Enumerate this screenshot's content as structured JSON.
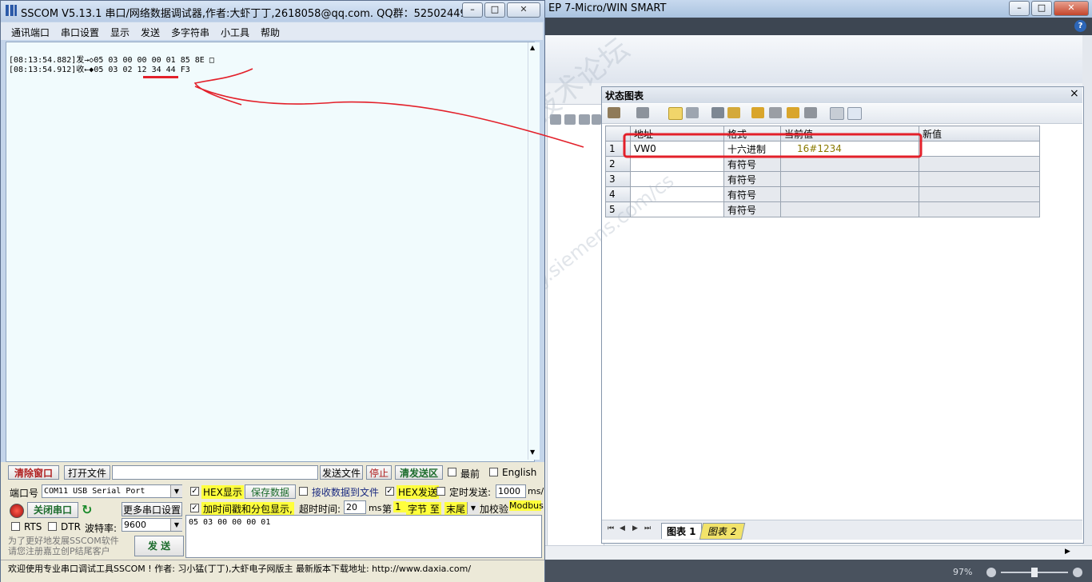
{
  "step7": {
    "title": "EP 7-Micro/WIN SMART",
    "zoom": "97%",
    "min": "–",
    "max": "□",
    "close": "✕",
    "help": "?"
  },
  "status_chart": {
    "title": "状态图表",
    "close": "×",
    "headers": [
      "",
      "地址",
      "格式",
      "当前值",
      "新值"
    ],
    "rows": [
      {
        "n": "1",
        "address": "VW0",
        "format": "十六进制",
        "current": "16#1234",
        "new": ""
      },
      {
        "n": "2",
        "address": "",
        "format": "有符号",
        "current": "",
        "new": ""
      },
      {
        "n": "3",
        "address": "",
        "format": "有符号",
        "current": "",
        "new": ""
      },
      {
        "n": "4",
        "address": "",
        "format": "有符号",
        "current": "",
        "new": ""
      },
      {
        "n": "5",
        "address": "",
        "format": "有符号",
        "current": "",
        "new": ""
      }
    ],
    "tabs": [
      "图表 1",
      "图表 2"
    ],
    "nav": [
      "⏮",
      "◀",
      "▶",
      "⏭"
    ]
  },
  "sscom": {
    "title": "SSCOM V5.13.1 串口/网络数据调试器,作者:大虾丁丁,2618058@qq.com. QQ群：52502449",
    "menu": [
      "通讯端口",
      "串口设置",
      "显示",
      "发送",
      "多字符串",
      "小工具",
      "帮助"
    ],
    "log": [
      "[08:13:54.882]发→◇05 03 00 00 00 01 85 8E □",
      "[08:13:54.912]收←◆05 03 02 12 34 44 F3"
    ],
    "buttons": {
      "clear": "清除窗口",
      "open_file": "打开文件",
      "send_file": "发送文件",
      "stop": "停止",
      "clear_send": "清发送区",
      "save_data": "保存数据",
      "close_port": "关闭串口",
      "more_settings": "更多串口设置",
      "send": "发 送"
    },
    "checks": {
      "front": "最前",
      "english": "English",
      "hex_display": "HEX显示",
      "recv_to_file": "接收数据到文件",
      "hex_send": "HEX发送",
      "timed_send": "定时发送:",
      "timestamp": "加时间戳和分包显示,",
      "rts": "RTS",
      "dtr": "DTR",
      "checksum": "加校验",
      "modbus": "Modbus"
    },
    "labels": {
      "port": "端口号",
      "baud": "波特率:",
      "timeout": "超时时间:",
      "ms": "ms",
      "ms_per": "ms/",
      "di": "第",
      "byte_to": "字节 至",
      "promo": "为了更好地发展SSCOM软件\n请您注册嘉立创P结尾客户"
    },
    "values": {
      "port": "COM11 USB Serial Port",
      "baud": "9600",
      "timeout": "20",
      "interval": "1000",
      "byte_from": "1",
      "byte_end": "末尾",
      "send_text": "05 03 00 00 00 01"
    },
    "status": "欢迎使用专业串口调试工具SSCOM ! 作者: 习小猛(丁丁),大虾电子网版主 最新版本下载地址: http://www.daxia.com/"
  },
  "watermark": {
    "text": "西门子工业 技术论坛",
    "url": "support.industry.siemens.com/cs"
  },
  "colors": {
    "highlight_box": "#e3202a",
    "annotation_arrow": "#e3202a",
    "current_value": "#8a7a00",
    "yellow": "#ffff3c"
  }
}
